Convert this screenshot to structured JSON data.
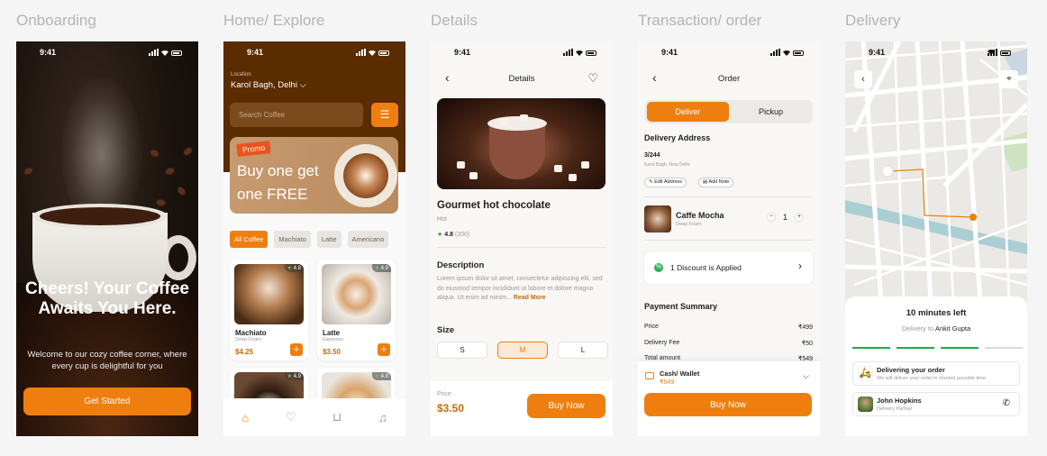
{
  "section_labels": {
    "onboarding": "Onboarding",
    "home": "Home/ Explore",
    "details": "Details",
    "order": "Transaction/ order",
    "delivery": "Delivery"
  },
  "status_time": "9:41",
  "onboarding": {
    "title": "Cheers! Your Coffee Awaits You Here.",
    "subtitle": "Welcome to our cozy coffee corner, where every cup is delightful for you",
    "cta": "Get Started"
  },
  "home": {
    "location_label": "Location",
    "location": "Karol Bagh, Delhi",
    "search_placeholder": "Search Coffee",
    "promo_tag": "Promo",
    "promo_text": "Buy one get one FREE",
    "chips": [
      "All Coffee",
      "Machiato",
      "Latte",
      "Americano"
    ],
    "products": [
      {
        "name": "Machiato",
        "sub": "Deep Foam",
        "price": "$4.25",
        "rating": "4.8"
      },
      {
        "name": "Latte",
        "sub": "Espresso",
        "price": "$3.50",
        "rating": "4.9"
      },
      {
        "name": "",
        "sub": "",
        "price": "",
        "rating": "4.9"
      },
      {
        "name": "",
        "sub": "",
        "price": "",
        "rating": "4.9"
      }
    ]
  },
  "details": {
    "header": "Details",
    "title": "Gourmet hot chocolate",
    "subtitle": "Hot",
    "rating": "4.8",
    "rating_count": "(200)",
    "description_title": "Description",
    "description": "Lorem ipsum dolor sit amet, consectetur adipiscing elit, sed do eiusmod tempor incididunt ut labore et dolore magna aliqua. Ut enim ad minim...",
    "read_more": "Read More",
    "size_title": "Size",
    "sizes": [
      "S",
      "M",
      "L"
    ],
    "price_label": "Price",
    "price": "$3.50",
    "cta": "Buy Now"
  },
  "order": {
    "header": "Order",
    "tabs": [
      "Deliver",
      "Pickup"
    ],
    "address_title": "Delivery Address",
    "address_line1": "3/244",
    "address_line2": "Karol Bagh, New Delhi",
    "edit_address": "Edit Address",
    "add_note": "Add Note",
    "item_name": "Caffe Mocha",
    "item_sub": "Deep Foam",
    "quantity": "1",
    "discount": "1 Discount is Applied",
    "summary_title": "Payment Summary",
    "summary": [
      {
        "label": "Price",
        "value": "₹499"
      },
      {
        "label": "Delivery Fee",
        "value": "₹50"
      },
      {
        "label": "Total amount",
        "value": "₹549"
      }
    ],
    "payment_method": "Cash/ Wallet",
    "payment_amount": "₹549",
    "cta": "Buy Now"
  },
  "delivery": {
    "eta": "10 minutes left",
    "delivery_to_label": "Delivery to",
    "delivery_to": "Ankit Gupta",
    "progress_steps_complete": 3,
    "progress_steps_total": 4,
    "status_title": "Delivering your order",
    "status_sub": "We will deliver your order in shorted possible time.",
    "partner_name": "John Hopkins",
    "partner_role": "Delivery Partner"
  },
  "colors": {
    "accent": "#ee7f0e",
    "brown": "#5a2c00",
    "green": "#27a74a"
  }
}
